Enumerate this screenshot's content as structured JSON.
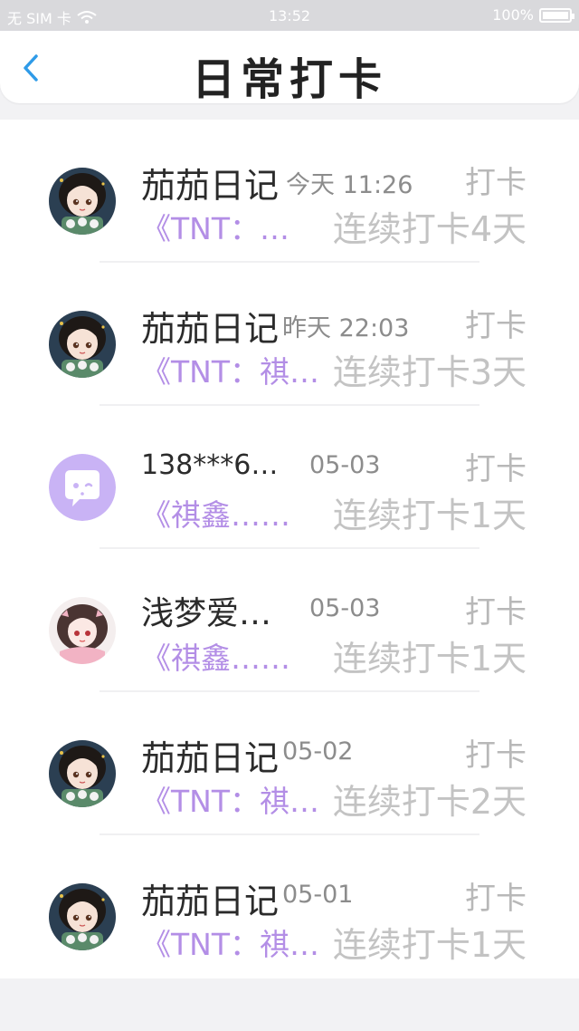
{
  "status_bar": {
    "carrier": "无 SIM 卡",
    "time": "13:52",
    "battery": "100%"
  },
  "header": {
    "title": "日常打卡"
  },
  "icons": {
    "back": "chevron-left-icon",
    "wifi": "wifi-icon",
    "battery": "battery-icon",
    "default_avatar": "chat-face-icon"
  },
  "colors": {
    "accent_blue": "#2f9be8",
    "preview_purple": "#b38ee6",
    "avatar_purple": "#c9b3f5"
  },
  "checkins": [
    {
      "name": "茄茄日记",
      "time": "今天 11:26",
      "action": "打卡",
      "preview": "《TNT：…",
      "streak": "连续打卡4天",
      "avatar": "anime-girl-dark"
    },
    {
      "name": "茄茄日记",
      "time": "昨天 22:03",
      "action": "打卡",
      "preview": "《TNT：祺…",
      "streak": "连续打卡3天",
      "avatar": "anime-girl-dark"
    },
    {
      "name": "138***6…",
      "time": "05-03",
      "action": "打卡",
      "preview": "《祺鑫……",
      "streak": "连续打卡1天",
      "avatar": "default-purple"
    },
    {
      "name": "浅梦爱…",
      "time": "05-03",
      "action": "打卡",
      "preview": "《祺鑫……",
      "streak": "连续打卡1天",
      "avatar": "anime-girl-pink"
    },
    {
      "name": "茄茄日记",
      "time": "05-02",
      "action": "打卡",
      "preview": "《TNT：祺…",
      "streak": "连续打卡2天",
      "avatar": "anime-girl-dark"
    },
    {
      "name": "茄茄日记",
      "time": "05-01",
      "action": "打卡",
      "preview": "《TNT：祺…",
      "streak": "连续打卡1天",
      "avatar": "anime-girl-dark"
    }
  ]
}
